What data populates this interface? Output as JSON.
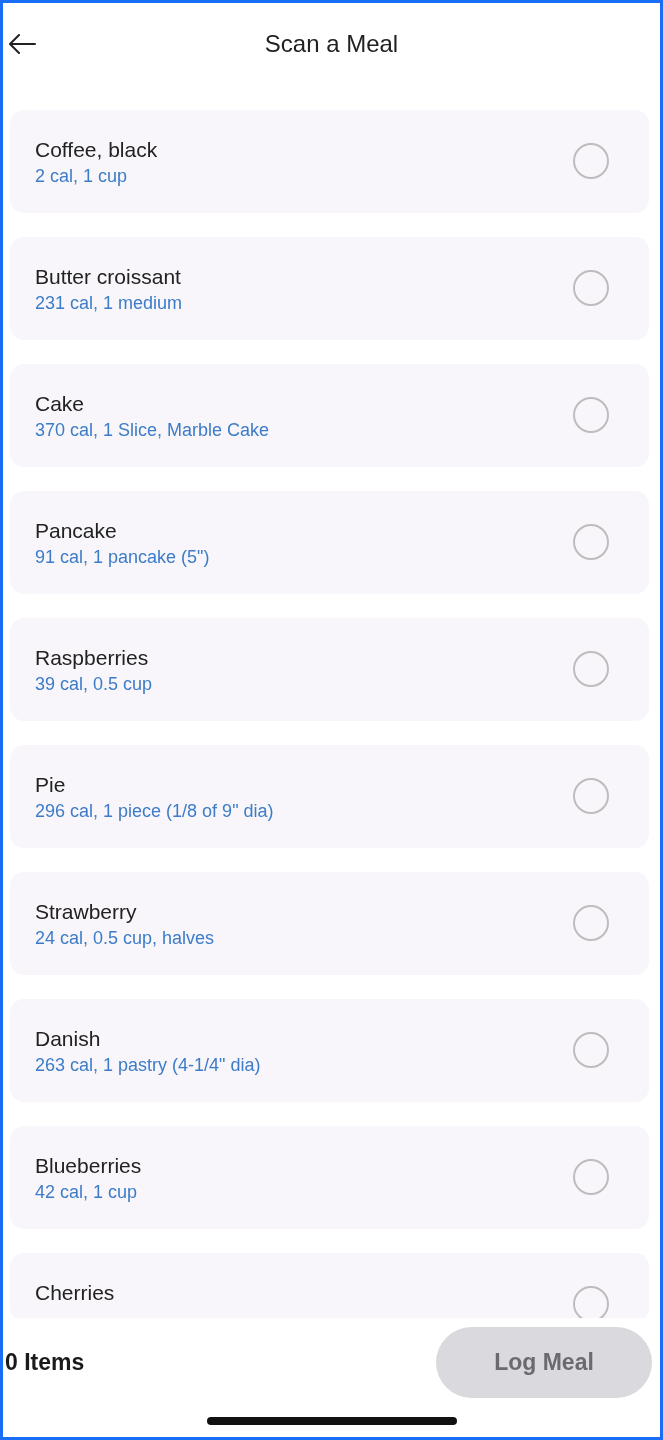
{
  "header": {
    "title": "Scan a Meal"
  },
  "foods": [
    {
      "name": "Coffee, black",
      "detail": "2 cal, 1 cup",
      "selected": false
    },
    {
      "name": "Butter croissant",
      "detail": "231 cal, 1 medium",
      "selected": false
    },
    {
      "name": "Cake",
      "detail": "370 cal, 1 Slice, Marble Cake",
      "selected": false
    },
    {
      "name": "Pancake",
      "detail": "91 cal, 1 pancake (5\")",
      "selected": false
    },
    {
      "name": "Raspberries",
      "detail": "39 cal, 0.5 cup",
      "selected": false
    },
    {
      "name": "Pie",
      "detail": "296 cal, 1 piece (1/8 of 9\" dia)",
      "selected": false
    },
    {
      "name": "Strawberry",
      "detail": "24 cal, 0.5 cup, halves",
      "selected": false
    },
    {
      "name": "Danish",
      "detail": "263 cal, 1 pastry (4-1/4\" dia)",
      "selected": false
    },
    {
      "name": "Blueberries",
      "detail": "42 cal, 1 cup",
      "selected": false
    },
    {
      "name": "Cherries",
      "selected": false
    }
  ],
  "footer": {
    "item_count": "0 Items",
    "log_button": {
      "label": "Log Meal",
      "disabled": true
    }
  }
}
